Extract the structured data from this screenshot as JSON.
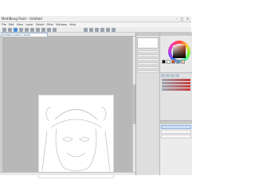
{
  "window": {
    "title": "MediBang Paint - Untitled",
    "controls": [
      "–",
      "□",
      "×"
    ]
  },
  "menu": [
    "File",
    "Edit",
    "View",
    "Layer",
    "Select",
    "Filter",
    "Window",
    "Help"
  ],
  "document_tab": {
    "label": "Untitled (1024 x 1024)"
  },
  "colors": {
    "swatches": [
      "#000000",
      "#ffffff",
      "#c8502a",
      "#4a8fd6",
      "#f0c8a0"
    ]
  }
}
